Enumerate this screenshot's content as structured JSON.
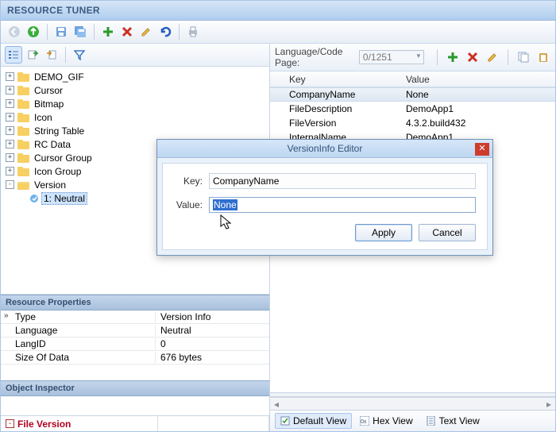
{
  "app_title": "RESOURCE TUNER",
  "tree": {
    "items": [
      "DEMO_GIF",
      "Cursor",
      "Bitmap",
      "Icon",
      "String Table",
      "RC Data",
      "Cursor Group",
      "Icon Group",
      "Version"
    ],
    "version_child": "1: Neutral"
  },
  "res_props": {
    "header": "Resource Properties",
    "rows": [
      {
        "k": "Type",
        "v": "Version Info"
      },
      {
        "k": "Language",
        "v": "Neutral"
      },
      {
        "k": "LangID",
        "v": "0"
      },
      {
        "k": "Size Of Data",
        "v": "676 bytes"
      }
    ]
  },
  "obj_inspector_header": "Object Inspector",
  "footer_left": "File Version",
  "right": {
    "lang_label": "Language/Code Page:",
    "lang_value": "0/1251",
    "columns": {
      "key": "Key",
      "value": "Value"
    },
    "rows": [
      {
        "k": "CompanyName",
        "v": "None",
        "sel": true
      },
      {
        "k": "FileDescription",
        "v": "DemoApp1"
      },
      {
        "k": "FileVersion",
        "v": "4.3.2.build432"
      },
      {
        "k": "InternalName",
        "v": "DemoApp1"
      }
    ],
    "views": {
      "default": "Default View",
      "hex": "Hex View",
      "text": "Text View"
    }
  },
  "dialog": {
    "title": "VersionInfo Editor",
    "key_label": "Key:",
    "key_value": "CompanyName",
    "value_label": "Value:",
    "value_value": "None",
    "apply": "Apply",
    "cancel": "Cancel"
  }
}
